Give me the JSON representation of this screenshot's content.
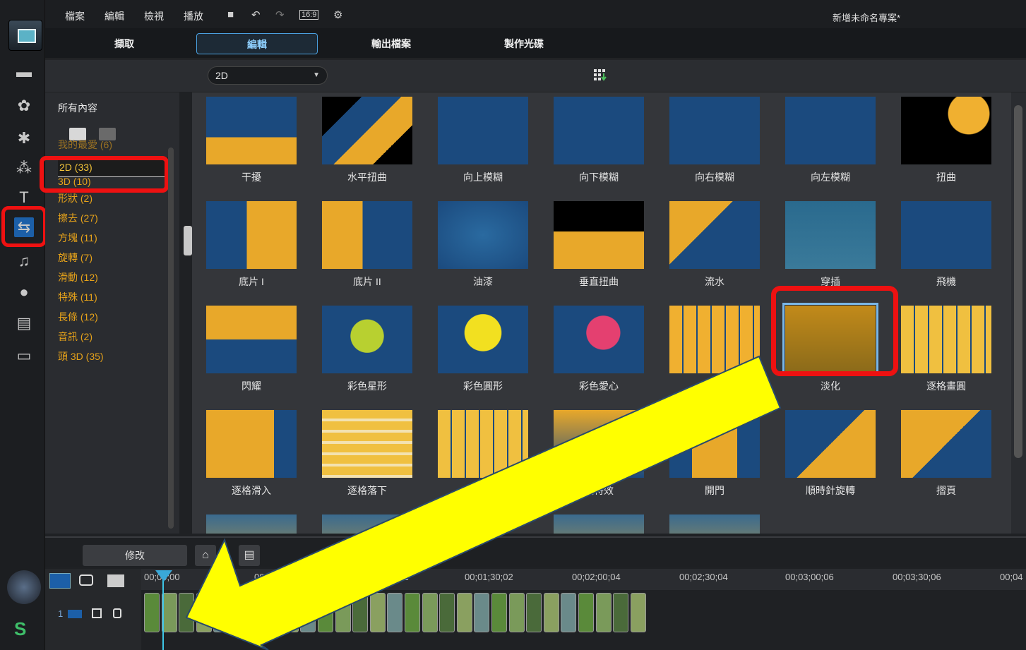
{
  "menu": {
    "items": [
      "檔案",
      "編輯",
      "檢視",
      "播放"
    ],
    "aspect_ratio": "16:9",
    "project_title": "新增未命名專案*"
  },
  "modes": [
    "擷取",
    "編輯",
    "輸出檔案",
    "製作光碟"
  ],
  "active_mode": "編輯",
  "filter": {
    "dropdown_value": "2D"
  },
  "categories": {
    "header": "所有內容",
    "items": [
      "我的最愛 (6)",
      "2D (33)",
      "3D (10)",
      "形狀 (2)",
      "擦去 (27)",
      "方塊 (11)",
      "旋轉 (7)",
      "滑動 (12)",
      "特殊 (11)",
      "長條 (12)",
      "音訊 (2)",
      "頭 3D (35)"
    ],
    "selected": "2D (33)"
  },
  "transitions": [
    "干擾",
    "水平扭曲",
    "向上模糊",
    "向下模糊",
    "向右模糊",
    "向左模糊",
    "扭曲",
    "底片 I",
    "底片 II",
    "油漆",
    "垂直扭曲",
    "流水",
    "穿插",
    "飛機",
    "閃耀",
    "彩色星形",
    "彩色圓形",
    "彩色愛心",
    "",
    "淡化",
    "逐格畫圓",
    "逐格滑入",
    "逐格落下",
    "",
    "無特效",
    "開門",
    "順時針旋轉",
    "摺頁"
  ],
  "selected_transition": "淡化",
  "timeline": {
    "modify_label": "修改",
    "track_number": "1",
    "ruler": [
      "00;00;00",
      "00;00;30;00",
      "00;01;00;02",
      "00;01;30;02",
      "00;02;00;04",
      "00;02;30;04",
      "00;03;00;06",
      "00;03;30;06",
      "00;04"
    ]
  },
  "colors": {
    "accent_gold": "#e6a21a",
    "highlight_red": "#ee1111",
    "arrow_yellow": "#ffff00",
    "transition_blue": "#1b4a7e"
  },
  "icons": {
    "rail": [
      "media-room-icon",
      "fx-room-icon",
      "particle-room-icon",
      "title-room-icon",
      "transition-room-icon",
      "audio-mix-icon",
      "voice-record-icon",
      "chapter-icon",
      "subtitle-icon"
    ]
  }
}
